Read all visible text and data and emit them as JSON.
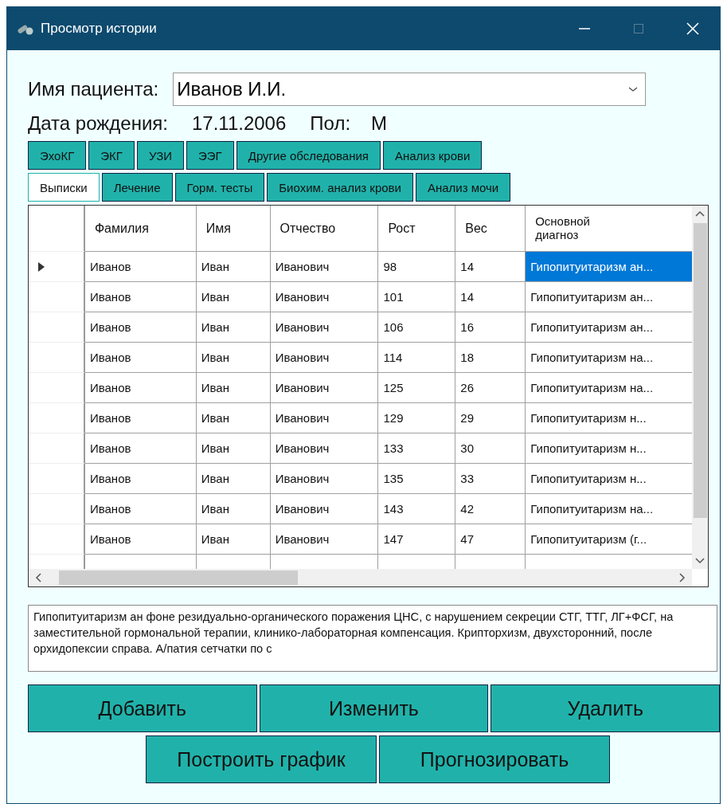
{
  "window": {
    "title": "Просмотр истории"
  },
  "patient": {
    "label": "Имя пациента:",
    "value": "Иванов И.И."
  },
  "birth": {
    "label": "Дата рождения:",
    "value": "17.11.2006",
    "sex_label": "Пол:",
    "sex_value": "М"
  },
  "tab_rows": [
    [
      {
        "label": "ЭхоКГ",
        "selected": false
      },
      {
        "label": "ЭКГ",
        "selected": false
      },
      {
        "label": "УЗИ",
        "selected": false
      },
      {
        "label": "ЭЭГ",
        "selected": false
      },
      {
        "label": "Другие обследования",
        "selected": false
      },
      {
        "label": "Анализ крови",
        "selected": false
      }
    ],
    [
      {
        "label": "Выписки",
        "selected": true
      },
      {
        "label": "Лечение",
        "selected": false
      },
      {
        "label": "Горм. тесты",
        "selected": false
      },
      {
        "label": "Биохим. анализ крови",
        "selected": false
      },
      {
        "label": "Анализ мочи",
        "selected": false
      }
    ]
  ],
  "table": {
    "columns": [
      "Фамилия",
      "Имя",
      "Отчество",
      "Рост",
      "Вес",
      "Основной диагноз"
    ],
    "rows": [
      {
        "selected": true,
        "cells": [
          "Иванов",
          "Иван",
          "Иванович",
          "98",
          "14",
          "Гипопитуитаризм ан..."
        ]
      },
      {
        "selected": false,
        "cells": [
          "Иванов",
          "Иван",
          "Иванович",
          "101",
          "14",
          "Гипопитуитаризм ан..."
        ]
      },
      {
        "selected": false,
        "cells": [
          "Иванов",
          "Иван",
          "Иванович",
          "106",
          "16",
          "Гипопитуитаризм ан..."
        ]
      },
      {
        "selected": false,
        "cells": [
          "Иванов",
          "Иван",
          "Иванович",
          "114",
          "18",
          "Гипопитуитаризм на..."
        ]
      },
      {
        "selected": false,
        "cells": [
          "Иванов",
          "Иван",
          "Иванович",
          "125",
          "26",
          "Гипопитуитаризм на..."
        ]
      },
      {
        "selected": false,
        "cells": [
          "Иванов",
          "Иван",
          "Иванович",
          "129",
          "29",
          "Гипопитуитаризм  н..."
        ]
      },
      {
        "selected": false,
        "cells": [
          "Иванов",
          "Иван",
          "Иванович",
          "133",
          "30",
          "Гипопитуитаризм  н..."
        ]
      },
      {
        "selected": false,
        "cells": [
          "Иванов",
          "Иван",
          "Иванович",
          "135",
          "33",
          "Гипопитуитаризм  н..."
        ]
      },
      {
        "selected": false,
        "cells": [
          "Иванов",
          "Иван",
          "Иванович",
          "143",
          "42",
          "Гипопитуитаризм на..."
        ]
      },
      {
        "selected": false,
        "cells": [
          "Иванов",
          "Иван",
          "Иванович",
          "147",
          "47",
          "Гипопитуитаризм (г..."
        ]
      }
    ]
  },
  "description": "Гипопитуитаризм ан фоне резидуально-органического поражения ЦНС, с нарушением секреции СТГ, ТТГ, ЛГ+ФСГ, на заместительной гормональной терапии, клинико-лабораторная компенсация. Крипторхизм, двухсторонний, после орхидопексии справа. А/патия сетчатки по с",
  "buttons": [
    [
      "Добавить",
      "Изменить",
      "Удалить"
    ],
    [
      "Построить график",
      "Прогнозировать"
    ]
  ]
}
